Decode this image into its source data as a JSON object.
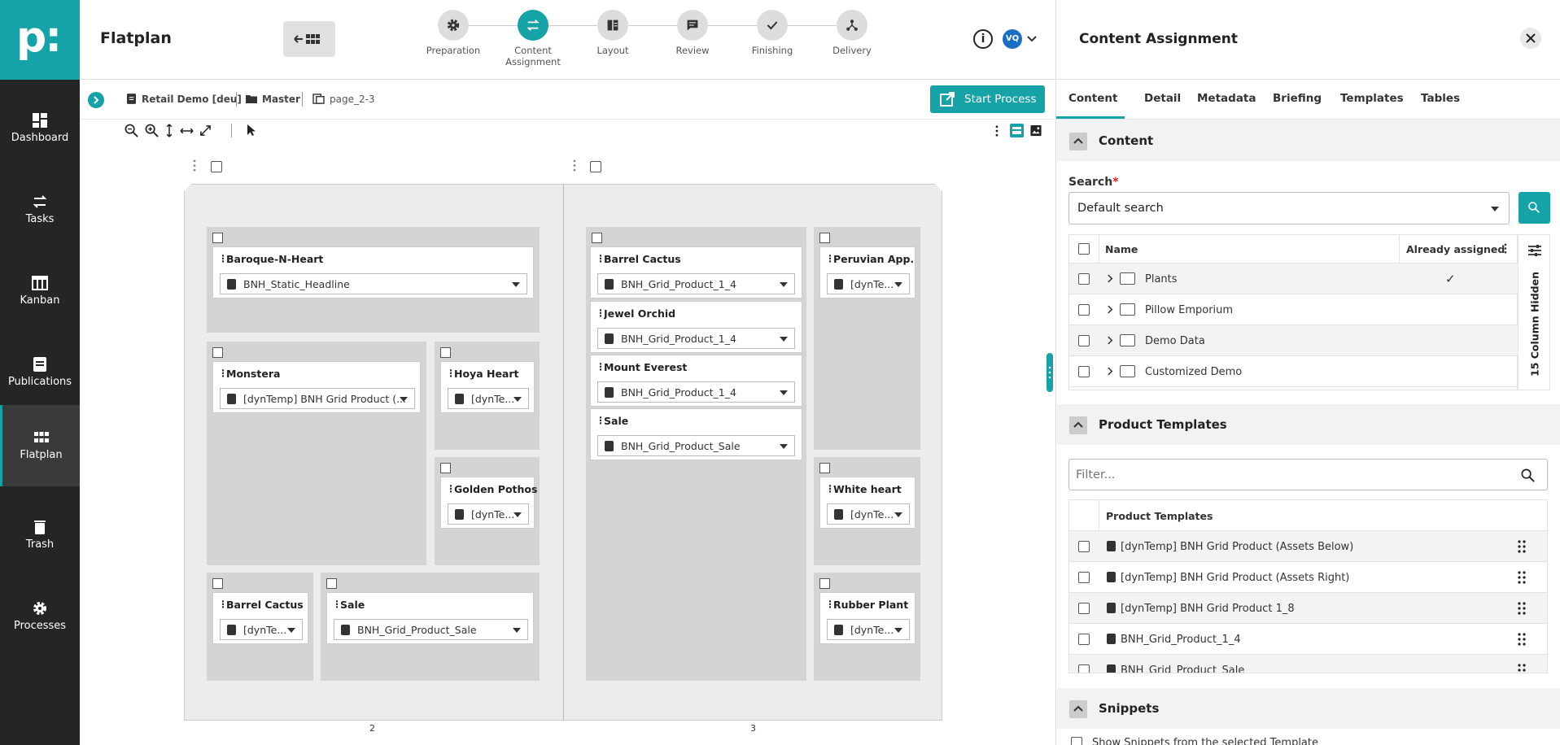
{
  "brand": {
    "accent": "#15a3a8",
    "sidebar_bg": "#252525"
  },
  "logo": "p:",
  "app_title": "Flatplan",
  "sidebar": {
    "items": [
      {
        "label": "Dashboard",
        "icon": "dashboard-icon"
      },
      {
        "label": "Tasks",
        "icon": "swap-icon"
      },
      {
        "label": "Kanban",
        "icon": "kanban-icon"
      },
      {
        "label": "Publications",
        "icon": "publication-icon"
      },
      {
        "label": "Flatplan",
        "icon": "grid-icon"
      },
      {
        "label": "Trash",
        "icon": "trash-icon"
      },
      {
        "label": "Processes",
        "icon": "gear-icon"
      }
    ]
  },
  "steps": [
    {
      "label": "Preparation",
      "icon": "gear-icon"
    },
    {
      "label": "Content Assignment",
      "icon": "swap-icon"
    },
    {
      "label": "Layout",
      "icon": "layout-icon"
    },
    {
      "label": "Review",
      "icon": "comment-icon"
    },
    {
      "label": "Finishing",
      "icon": "check-icon"
    },
    {
      "label": "Delivery",
      "icon": "share-icon"
    }
  ],
  "user_initials": "VQ",
  "breadcrumb": {
    "publication": "Retail Demo [deu]",
    "folder": "Master",
    "page": "page_2-3"
  },
  "start_process_label": "Start Process",
  "pages": [
    {
      "number": "2"
    },
    {
      "number": "3"
    }
  ],
  "cards": {
    "bnh": {
      "title": "Baroque-N-Heart",
      "value": "BNH_Static_Headline"
    },
    "monstera": {
      "title": "Monstera",
      "value": "[dynTemp] BNH Grid Product (..."
    },
    "hoya": {
      "title": "Hoya Heart",
      "value": "[dynTe..."
    },
    "pothos": {
      "title": "Golden Pothos",
      "value": "[dynTe..."
    },
    "cactus_l": {
      "title": "Barrel Cactus",
      "value": "[dynTe..."
    },
    "sale_l": {
      "title": "Sale",
      "value": "BNH_Grid_Product_Sale"
    },
    "cactus_r": {
      "title": "Barrel Cactus",
      "value": "BNH_Grid_Product_1_4"
    },
    "orchid": {
      "title": "Jewel Orchid",
      "value": "BNH_Grid_Product_1_4"
    },
    "everest": {
      "title": "Mount Everest",
      "value": "BNH_Grid_Product_1_4"
    },
    "sale_r": {
      "title": "Sale",
      "value": "BNH_Grid_Product_Sale"
    },
    "peruvian": {
      "title": "Peruvian App...",
      "value": "[dynTe..."
    },
    "white": {
      "title": "White heart",
      "value": "[dynTe..."
    },
    "rubber": {
      "title": "Rubber Plant",
      "value": "[dynTe..."
    }
  },
  "panel": {
    "title": "Content Assignment",
    "tabs": [
      "Content",
      "Detail",
      "Metadata",
      "Briefing",
      "Templates",
      "Tables"
    ],
    "content_section": "Content",
    "search_label": "Search",
    "required_mark": "*",
    "search_value": "Default search",
    "columns": {
      "name": "Name",
      "assigned": "Already assigned"
    },
    "hidden_columns": "15 Column Hidden",
    "rows": [
      {
        "name": "Plants",
        "assigned": "✓"
      },
      {
        "name": "Pillow Emporium",
        "assigned": ""
      },
      {
        "name": "Demo Data",
        "assigned": ""
      },
      {
        "name": "Customized Demo",
        "assigned": ""
      }
    ],
    "product_templates_section": "Product Templates",
    "filter_placeholder": "Filter...",
    "templates_header": "Product Templates",
    "templates": [
      "[dynTemp] BNH Grid Product (Assets Below)",
      "[dynTemp] BNH Grid Product (Assets Right)",
      "[dynTemp] BNH Grid Product 1_8",
      "BNH_Grid_Product_1_4",
      "BNH_Grid_Product_Sale"
    ],
    "snippets_section": "Snippets",
    "snippets_option": "Show Snippets from the selected Template"
  }
}
